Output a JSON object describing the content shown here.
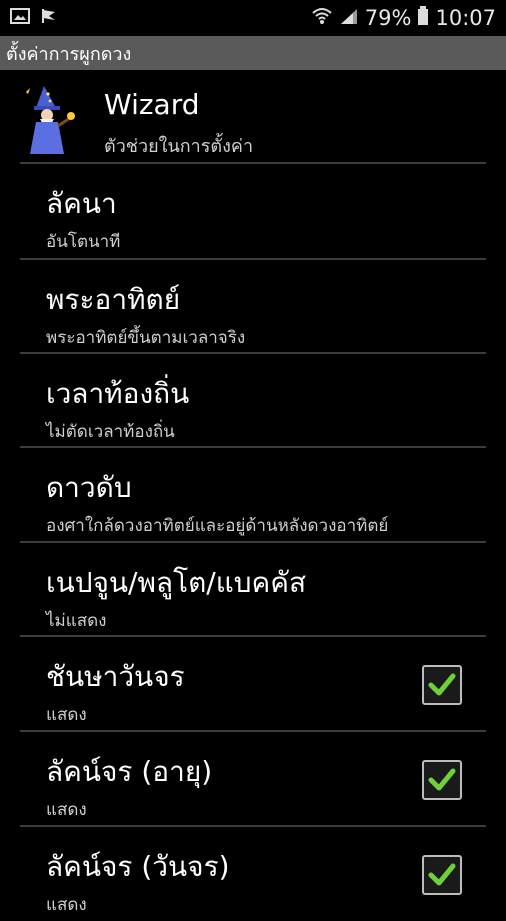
{
  "status_bar": {
    "battery_percent": "79%",
    "time": "10:07",
    "icons": [
      "image-icon",
      "flag-icon",
      "wifi-icon",
      "signal-icon",
      "battery-icon"
    ]
  },
  "title_bar": {
    "title": "ตั้งค่าการผูกดวง"
  },
  "wizard": {
    "title": "Wizard",
    "subtitle": "ตัวช่วยในการตั้งค่า"
  },
  "items": [
    {
      "title": "ลัคนา",
      "subtitle": "อันโตนาที"
    },
    {
      "title": "พระอาทิตย์",
      "subtitle": "พระอาทิตย์ขึ้นตามเวลาจริง"
    },
    {
      "title": "เวลาท้องถิ่น",
      "subtitle": "ไม่ตัดเวลาท้องถิ่น"
    },
    {
      "title": "ดาวดับ",
      "subtitle": "องศาใกล้ดวงอาทิตย์และอยู่ด้านหลังดวงอาทิตย์"
    },
    {
      "title": "เนปจูน/พลูโต/แบคคัส",
      "subtitle": "ไม่แสดง"
    },
    {
      "title": "ชันษาวันจร",
      "subtitle": "แสดง",
      "checked": true
    },
    {
      "title": "ลัคน์จร (อายุ)",
      "subtitle": "แสดง",
      "checked": true
    },
    {
      "title": "ลัคน์จร (วันจร)",
      "subtitle": "แสดง",
      "checked": true
    }
  ],
  "colors": {
    "background": "#000000",
    "title_bar": "#5a5a5a",
    "check": "#6ed13a",
    "divider": "#3c3c3c"
  }
}
